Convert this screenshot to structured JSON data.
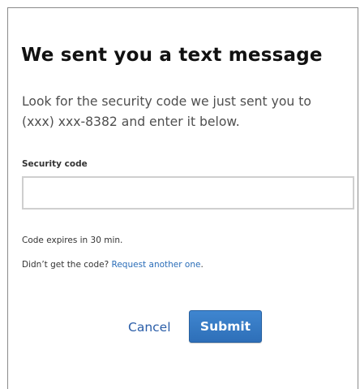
{
  "dialog": {
    "title": "We sent you a text message",
    "subtitle": "Look for the security code we just sent you to (xxx) xxx-8382 and enter it below."
  },
  "form": {
    "security_code_label": "Security code",
    "security_code_value": "",
    "expires_text": "Code expires in 30 min.",
    "resend_prefix": "Didn’t get the code?",
    "resend_link": "Request another one",
    "resend_suffix": "."
  },
  "actions": {
    "cancel_label": "Cancel",
    "submit_label": "Submit"
  },
  "colors": {
    "link": "#2a6db8",
    "primary_button": "#3578c2"
  }
}
